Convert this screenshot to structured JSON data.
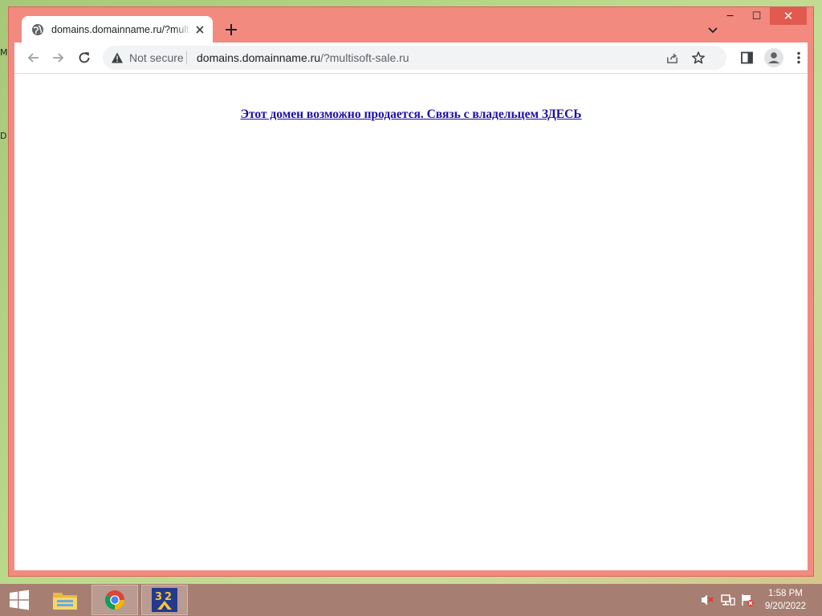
{
  "desktop": {
    "edge_labels": [
      "M",
      "D"
    ]
  },
  "window": {
    "controls": {
      "minimize": "─",
      "maximize": "☐",
      "close": "✕"
    }
  },
  "tab": {
    "title": "domains.domainname.ru/?multisoft-sale.ru",
    "icon": "globe-icon"
  },
  "toolbar": {
    "security_label": "Not secure",
    "url_host": "domains.domainname.ru",
    "url_rest": "/?multisoft-sale.ru"
  },
  "page": {
    "link_text": "Этот домен возможно продается. Связь с владельцем ЗДЕСЬ",
    "link_color": "#1a0dab"
  },
  "taskbar": {
    "time": "1:58 PM",
    "date": "9/20/2022",
    "apps": [
      "file-explorer",
      "chrome",
      "app-32"
    ]
  },
  "colors": {
    "window_frame": "#f28a80",
    "taskbar": "#a67f72"
  }
}
